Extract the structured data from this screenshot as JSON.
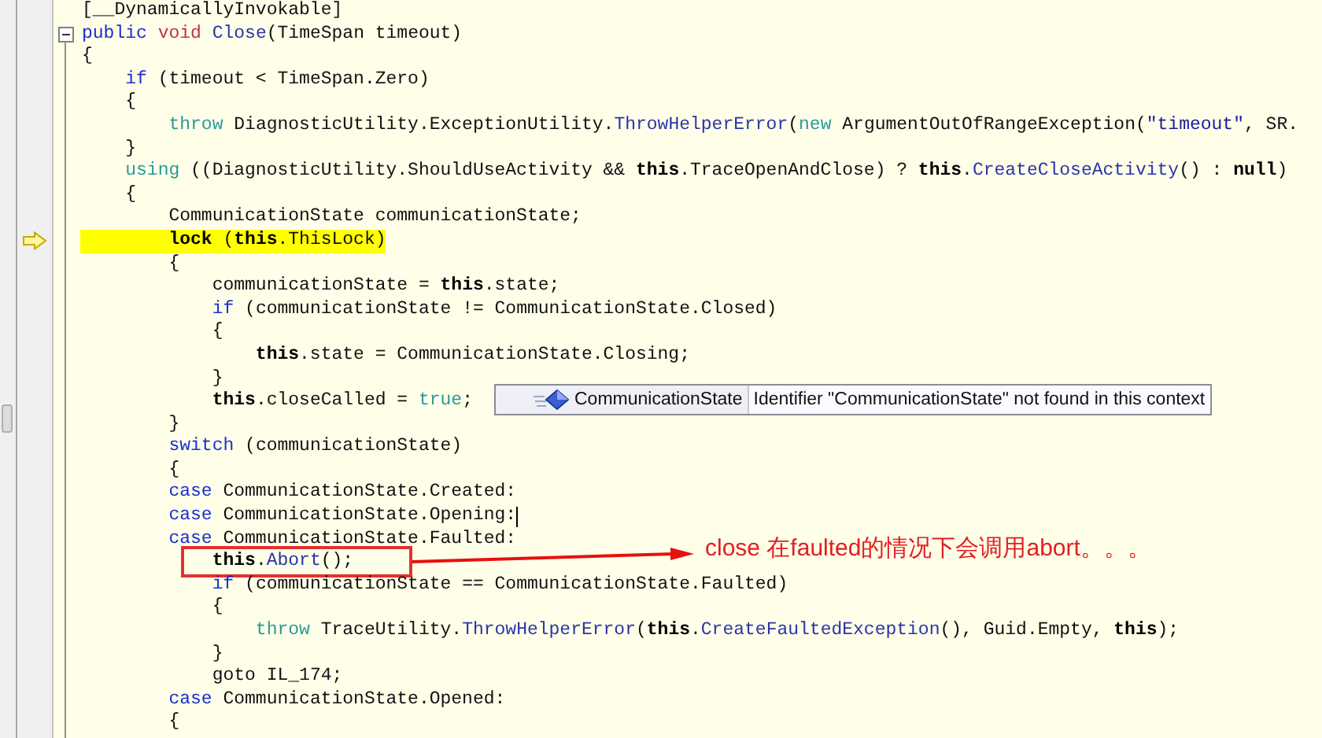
{
  "lines": [
    {
      "current": false,
      "caret": false,
      "fold": false,
      "tokens": [
        {
          "kind": "plain",
          "text": "[__DynamicallyInvokable]"
        }
      ]
    },
    {
      "current": false,
      "caret": false,
      "fold": true,
      "tokens": [
        {
          "kind": "keyword",
          "text": "public"
        },
        {
          "kind": "void",
          "text": " void"
        },
        {
          "kind": "method",
          "text": " Close"
        },
        {
          "kind": "plain",
          "text": "(TimeSpan timeout)"
        }
      ]
    },
    {
      "current": false,
      "caret": false,
      "fold": false,
      "tokens": [
        {
          "kind": "plain",
          "text": "{"
        }
      ]
    },
    {
      "current": false,
      "caret": false,
      "fold": false,
      "tokens": [
        {
          "kind": "keyword",
          "text": "    if"
        },
        {
          "kind": "plain",
          "text": " (timeout < TimeSpan.Zero)"
        }
      ]
    },
    {
      "current": false,
      "caret": false,
      "fold": false,
      "tokens": [
        {
          "kind": "plain",
          "text": "    {"
        }
      ]
    },
    {
      "current": false,
      "caret": false,
      "fold": false,
      "tokens": [
        {
          "kind": "keyword2",
          "text": "        throw"
        },
        {
          "kind": "plain",
          "text": " DiagnosticUtility.ExceptionUtility."
        },
        {
          "kind": "method",
          "text": "ThrowHelperError"
        },
        {
          "kind": "plain",
          "text": "("
        },
        {
          "kind": "keyword2",
          "text": "new"
        },
        {
          "kind": "plain",
          "text": " ArgumentOutOfRangeException("
        },
        {
          "kind": "string",
          "text": "\"timeout\""
        },
        {
          "kind": "plain",
          "text": ", SR."
        }
      ]
    },
    {
      "current": false,
      "caret": false,
      "fold": false,
      "tokens": [
        {
          "kind": "plain",
          "text": "    }"
        }
      ]
    },
    {
      "current": false,
      "caret": false,
      "fold": false,
      "tokens": [
        {
          "kind": "keyword2",
          "text": "    using"
        },
        {
          "kind": "plain",
          "text": " ((DiagnosticUtility.ShouldUseActivity && "
        },
        {
          "kind": "bold",
          "text": "this"
        },
        {
          "kind": "plain",
          "text": ".TraceOpenAndClose) ? "
        },
        {
          "kind": "bold",
          "text": "this"
        },
        {
          "kind": "plain",
          "text": "."
        },
        {
          "kind": "method",
          "text": "CreateCloseActivity"
        },
        {
          "kind": "plain",
          "text": "() : "
        },
        {
          "kind": "bold",
          "text": "null"
        },
        {
          "kind": "plain",
          "text": ")"
        }
      ]
    },
    {
      "current": false,
      "caret": false,
      "fold": false,
      "tokens": [
        {
          "kind": "plain",
          "text": "    {"
        }
      ]
    },
    {
      "current": false,
      "caret": false,
      "fold": false,
      "tokens": [
        {
          "kind": "plain",
          "text": "        CommunicationState communicationState;"
        }
      ]
    },
    {
      "current": true,
      "caret": false,
      "fold": false,
      "tokens": [
        {
          "kind": "bold",
          "text": "        lock"
        },
        {
          "kind": "plain",
          "text": " ("
        },
        {
          "kind": "bold",
          "text": "this"
        },
        {
          "kind": "plain",
          "text": ".ThisLock)"
        }
      ]
    },
    {
      "current": false,
      "caret": false,
      "fold": false,
      "tokens": [
        {
          "kind": "plain",
          "text": "        {"
        }
      ]
    },
    {
      "current": false,
      "caret": false,
      "fold": false,
      "tokens": [
        {
          "kind": "plain",
          "text": "            communicationState = "
        },
        {
          "kind": "bold",
          "text": "this"
        },
        {
          "kind": "plain",
          "text": ".state;"
        }
      ]
    },
    {
      "current": false,
      "caret": false,
      "fold": false,
      "tokens": [
        {
          "kind": "keyword",
          "text": "            if"
        },
        {
          "kind": "plain",
          "text": " (communicationState != CommunicationState.Closed)"
        }
      ]
    },
    {
      "current": false,
      "caret": false,
      "fold": false,
      "tokens": [
        {
          "kind": "plain",
          "text": "            {"
        }
      ]
    },
    {
      "current": false,
      "caret": false,
      "fold": false,
      "tokens": [
        {
          "kind": "bold",
          "text": "                this"
        },
        {
          "kind": "plain",
          "text": ".state = CommunicationState.Closing;"
        }
      ]
    },
    {
      "current": false,
      "caret": false,
      "fold": false,
      "tokens": [
        {
          "kind": "plain",
          "text": "            }"
        }
      ]
    },
    {
      "current": false,
      "caret": false,
      "fold": false,
      "tokens": [
        {
          "kind": "bold",
          "text": "            this"
        },
        {
          "kind": "plain",
          "text": ".closeCalled = "
        },
        {
          "kind": "keyword2",
          "text": "true"
        },
        {
          "kind": "plain",
          "text": ";"
        }
      ],
      "tooltip": {
        "symbol": "CommunicationState",
        "message": "Identifier \"CommunicationState\" not found in this context"
      }
    },
    {
      "current": false,
      "caret": false,
      "fold": false,
      "tokens": [
        {
          "kind": "plain",
          "text": "        }"
        }
      ]
    },
    {
      "current": false,
      "caret": false,
      "fold": false,
      "tokens": [
        {
          "kind": "keyword",
          "text": "        switch"
        },
        {
          "kind": "plain",
          "text": " (communicationState)"
        }
      ]
    },
    {
      "current": false,
      "caret": false,
      "fold": false,
      "tokens": [
        {
          "kind": "plain",
          "text": "        {"
        }
      ]
    },
    {
      "current": false,
      "caret": false,
      "fold": false,
      "tokens": [
        {
          "kind": "keyword",
          "text": "        case"
        },
        {
          "kind": "plain",
          "text": " CommunicationState.Created:"
        }
      ]
    },
    {
      "current": false,
      "caret": true,
      "fold": false,
      "tokens": [
        {
          "kind": "keyword",
          "text": "        case"
        },
        {
          "kind": "plain",
          "text": " CommunicationState.Opening:"
        }
      ]
    },
    {
      "current": false,
      "caret": false,
      "fold": false,
      "tokens": [
        {
          "kind": "keyword",
          "text": "        case"
        },
        {
          "kind": "plain",
          "text": " CommunicationState.Faulted:"
        }
      ]
    },
    {
      "current": false,
      "caret": false,
      "fold": false,
      "tokens": [
        {
          "kind": "bold",
          "text": "            this"
        },
        {
          "kind": "plain",
          "text": "."
        },
        {
          "kind": "method",
          "text": "Abort"
        },
        {
          "kind": "plain",
          "text": "();"
        }
      ],
      "callout": {
        "text": "close 在faulted的情况下会调用abort。。。"
      }
    },
    {
      "current": false,
      "caret": false,
      "fold": false,
      "tokens": [
        {
          "kind": "keyword",
          "text": "            if"
        },
        {
          "kind": "plain",
          "text": " (communicationState == CommunicationState.Faulted)"
        }
      ]
    },
    {
      "current": false,
      "caret": false,
      "fold": false,
      "tokens": [
        {
          "kind": "plain",
          "text": "            {"
        }
      ]
    },
    {
      "current": false,
      "caret": false,
      "fold": false,
      "tokens": [
        {
          "kind": "keyword2",
          "text": "                throw"
        },
        {
          "kind": "plain",
          "text": " TraceUtility."
        },
        {
          "kind": "method",
          "text": "ThrowHelperError"
        },
        {
          "kind": "plain",
          "text": "("
        },
        {
          "kind": "bold",
          "text": "this"
        },
        {
          "kind": "plain",
          "text": "."
        },
        {
          "kind": "method",
          "text": "CreateFaultedException"
        },
        {
          "kind": "plain",
          "text": "(), Guid.Empty, "
        },
        {
          "kind": "bold",
          "text": "this"
        },
        {
          "kind": "plain",
          "text": ");"
        }
      ]
    },
    {
      "current": false,
      "caret": false,
      "fold": false,
      "tokens": [
        {
          "kind": "plain",
          "text": "            }"
        }
      ]
    },
    {
      "current": false,
      "caret": false,
      "fold": false,
      "tokens": [
        {
          "kind": "plain",
          "text": "            goto IL_174;"
        }
      ]
    },
    {
      "current": false,
      "caret": false,
      "fold": false,
      "tokens": [
        {
          "kind": "keyword",
          "text": "        case"
        },
        {
          "kind": "plain",
          "text": " CommunicationState.Opened:"
        }
      ]
    },
    {
      "current": false,
      "caret": false,
      "fold": false,
      "tokens": [
        {
          "kind": "plain",
          "text": "        {"
        }
      ]
    }
  ]
}
